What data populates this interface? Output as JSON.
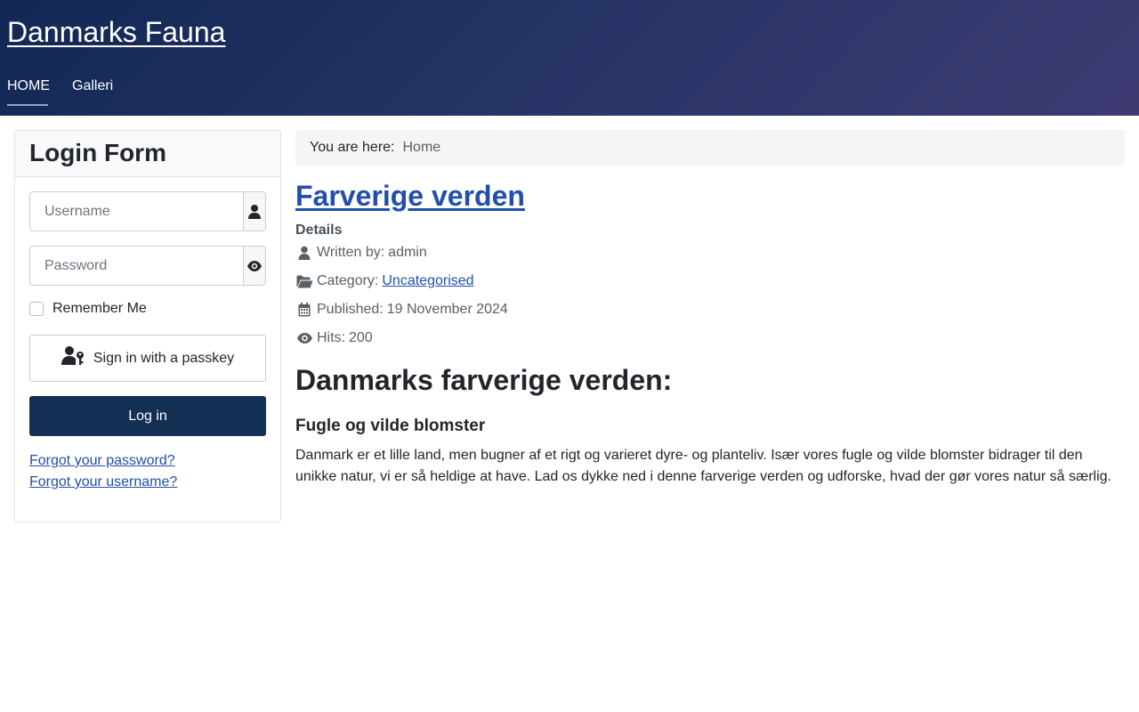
{
  "site": {
    "title": "Danmarks Fauna"
  },
  "nav": {
    "items": [
      {
        "label": "HOME",
        "active": true
      },
      {
        "label": "Galleri",
        "active": false
      }
    ]
  },
  "login": {
    "title": "Login Form",
    "username_placeholder": "Username",
    "password_placeholder": "Password",
    "remember_label": "Remember Me",
    "passkey_label": "Sign in with a passkey",
    "login_label": "Log in",
    "forgot_password": "Forgot your password?",
    "forgot_username": "Forgot your username?"
  },
  "breadcrumb": {
    "prefix": "You are here:",
    "items": [
      "Home"
    ]
  },
  "article": {
    "title": "Farverige verden",
    "details_label": "Details",
    "written_by_label": "Written by:",
    "author": "admin",
    "category_label": "Category:",
    "category": "Uncategorised",
    "published_label": "Published:",
    "published": "19 November 2024",
    "hits_label": "Hits:",
    "hits": "200",
    "heading": "Danmarks farverige verden:",
    "subheading": "Fugle og vilde blomster",
    "body": "Danmark er et lille land, men bugner af et rigt og varieret dyre- og planteliv. Især vores fugle og vilde blomster bidrager til den unikke natur, vi er så heldige at have. Lad os dykke ned i denne farverige verden og udforske, hvad der gør vores natur så særlig."
  },
  "colors": {
    "header_start": "#112855",
    "header_end": "#3e3b73",
    "link": "#224faa",
    "primary_button": "#132f53"
  },
  "icons": [
    "user-icon",
    "eye-icon",
    "passkey-icon",
    "folder-open-icon",
    "calendar-icon"
  ]
}
